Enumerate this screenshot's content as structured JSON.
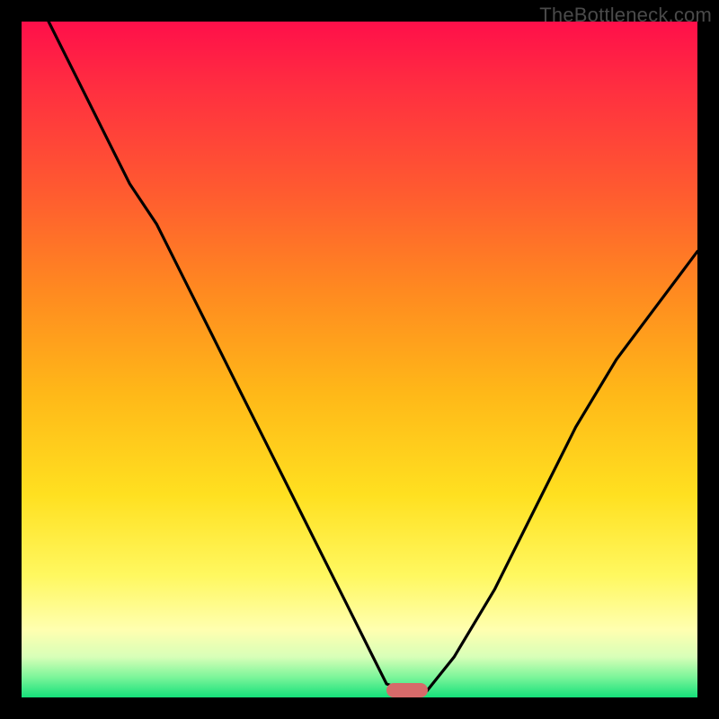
{
  "watermark": {
    "text": "TheBottleneck.com"
  },
  "colors": {
    "curve_stroke": "#000000",
    "marker_fill": "#d76a6a"
  },
  "chart_data": {
    "type": "line",
    "title": "",
    "xlabel": "",
    "ylabel": "",
    "xlim": [
      0,
      100
    ],
    "ylim": [
      0,
      100
    ],
    "grid": false,
    "legend": false,
    "note": "x and values are in percent of the visible plot area; values measured from bottom (0) to top (100).",
    "series": [
      {
        "name": "curve",
        "x": [
          0,
          4,
          8,
          12,
          16,
          20,
          24,
          28,
          32,
          36,
          40,
          44,
          48,
          52,
          54,
          57,
          60,
          64,
          70,
          76,
          82,
          88,
          94,
          100
        ],
        "values": [
          108,
          100,
          92,
          84,
          76,
          70,
          62,
          54,
          46,
          38,
          30,
          22,
          14,
          6,
          2,
          1,
          1,
          6,
          16,
          28,
          40,
          50,
          58,
          66
        ]
      }
    ],
    "marker": {
      "x_pct": 57,
      "y_pct": 1
    }
  }
}
